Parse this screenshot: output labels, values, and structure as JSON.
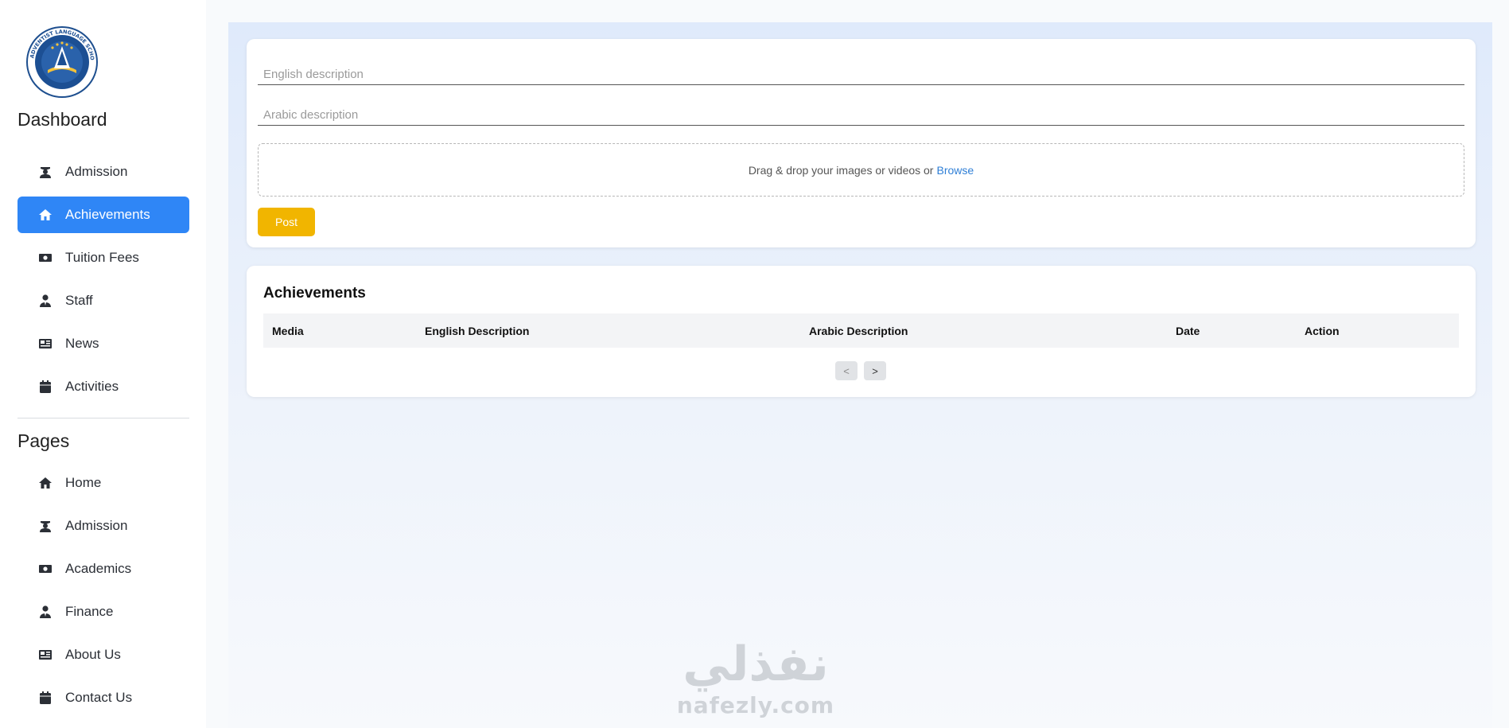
{
  "brand": {
    "logo_text": "ADVENTIST LANGUAGE SCHOOL",
    "accent": "#2f86f6",
    "post_color": "#f1b500"
  },
  "sidebar": {
    "dashboard_title": "Dashboard",
    "dashboard_items": [
      {
        "label": "Admission",
        "icon": "graduate-icon"
      },
      {
        "label": "Achievements",
        "icon": "home-icon",
        "active": true
      },
      {
        "label": "Tuition Fees",
        "icon": "money-icon"
      },
      {
        "label": "Staff",
        "icon": "user-tie-icon"
      },
      {
        "label": "News",
        "icon": "newspaper-icon"
      },
      {
        "label": "Activities",
        "icon": "calendar-icon"
      }
    ],
    "pages_title": "Pages",
    "pages_items": [
      {
        "label": "Home",
        "icon": "home-icon"
      },
      {
        "label": "Admission",
        "icon": "graduate-icon"
      },
      {
        "label": "Academics",
        "icon": "money-icon"
      },
      {
        "label": "Finance",
        "icon": "user-tie-icon"
      },
      {
        "label": "About Us",
        "icon": "newspaper-icon"
      },
      {
        "label": "Contact Us",
        "icon": "calendar-icon"
      }
    ]
  },
  "form": {
    "english_placeholder": "English description",
    "arabic_placeholder": "Arabic description",
    "dropzone_text": "Drag & drop your images or videos or",
    "browse_label": "Browse",
    "post_label": "Post"
  },
  "table": {
    "title": "Achievements",
    "columns": [
      "Media",
      "English Description",
      "Arabic Description",
      "Date",
      "Action"
    ],
    "prev_label": "<",
    "next_label": ">"
  },
  "watermark": {
    "arabic": "نفذلي",
    "latin": "nafezly.com"
  }
}
